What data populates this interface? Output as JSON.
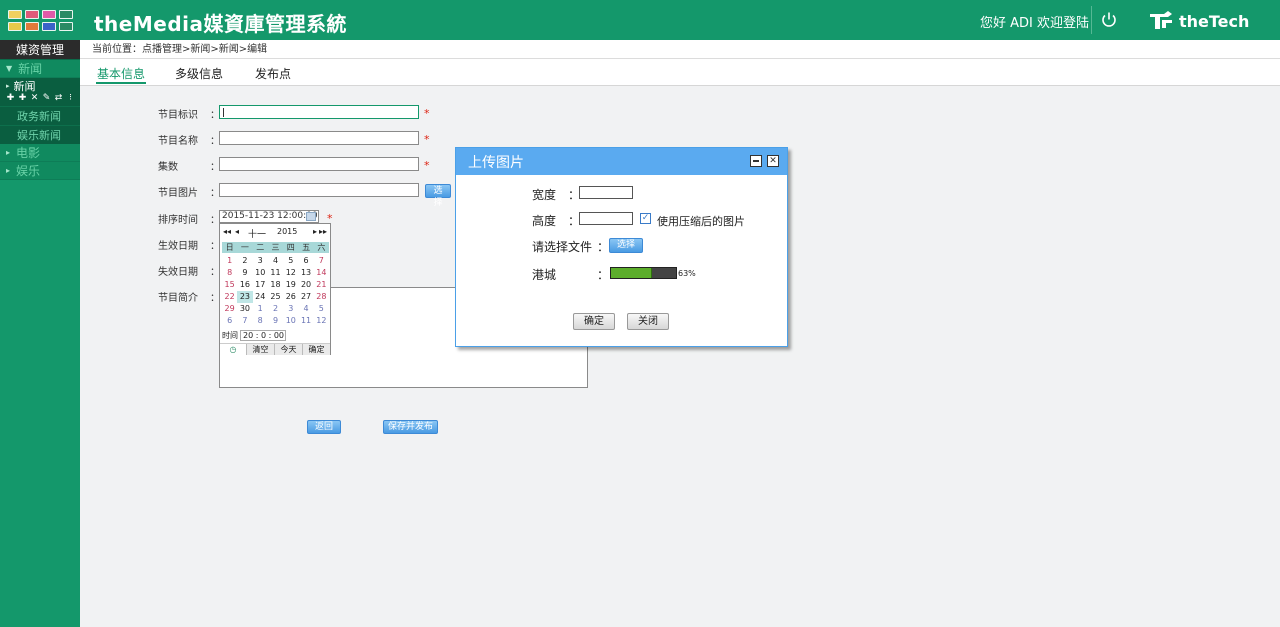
{
  "header": {
    "title": "theMedia媒資庫管理系統",
    "greeting": "您好 ADI 欢迎登陆",
    "brand": "theTech",
    "app_grid_colors": [
      "#f0d060",
      "#e05a7a",
      "#e05aa8",
      "#2a8a64",
      "#e8c94a",
      "#e07a3a",
      "#3a62c8",
      "#2a8a64"
    ]
  },
  "sidebar": {
    "top_label": "媒资管理",
    "sections": [
      {
        "label": "新闻"
      },
      {
        "label": "电影"
      },
      {
        "label": "娱乐"
      }
    ],
    "node_label": "新闻",
    "sub_items": [
      "政务新闻",
      "娱乐新闻"
    ]
  },
  "breadcrumb": "当前位置：点播管理>新闻>新闻>编辑",
  "tabs": [
    "基本信息",
    "多级信息",
    "发布点"
  ],
  "form": {
    "colon": "：",
    "required_mark": "*",
    "labels": {
      "id": "节目标识",
      "name": "节目名称",
      "episodes": "集数",
      "image": "节目图片",
      "sort_time": "排序时间",
      "effective_date": "生效日期",
      "expiry_date": "失效日期",
      "summary": "节目简介"
    },
    "values": {
      "id": "",
      "name": "",
      "episodes": "",
      "image": "",
      "sort_time": "2015-11-23 12:00:00"
    },
    "select_button": "选择",
    "back_button": "返回",
    "save_button": "保存并发布"
  },
  "datepicker": {
    "nav_prev_year": "◂◂",
    "nav_prev_month": "◂",
    "nav_next_month": "▸",
    "nav_next_year": "▸▸",
    "month": "十一",
    "year": "2015",
    "weekdays": [
      "日",
      "一",
      "二",
      "三",
      "四",
      "五",
      "六"
    ],
    "days": [
      {
        "d": "1",
        "t": "wkend"
      },
      {
        "d": "2"
      },
      {
        "d": "3"
      },
      {
        "d": "4"
      },
      {
        "d": "5"
      },
      {
        "d": "6"
      },
      {
        "d": "7",
        "t": "wkend"
      },
      {
        "d": "8",
        "t": "wkend"
      },
      {
        "d": "9"
      },
      {
        "d": "10"
      },
      {
        "d": "11"
      },
      {
        "d": "12"
      },
      {
        "d": "13"
      },
      {
        "d": "14",
        "t": "wkend"
      },
      {
        "d": "15",
        "t": "wkend"
      },
      {
        "d": "16"
      },
      {
        "d": "17"
      },
      {
        "d": "18"
      },
      {
        "d": "19"
      },
      {
        "d": "20"
      },
      {
        "d": "21",
        "t": "wkend"
      },
      {
        "d": "22",
        "t": "wkend"
      },
      {
        "d": "23",
        "t": "today"
      },
      {
        "d": "24"
      },
      {
        "d": "25"
      },
      {
        "d": "26"
      },
      {
        "d": "27"
      },
      {
        "d": "28",
        "t": "wkend"
      },
      {
        "d": "29",
        "t": "wkend"
      },
      {
        "d": "30"
      },
      {
        "d": "1",
        "t": "other"
      },
      {
        "d": "2",
        "t": "other"
      },
      {
        "d": "3",
        "t": "other"
      },
      {
        "d": "4",
        "t": "other"
      },
      {
        "d": "5",
        "t": "other"
      },
      {
        "d": "6",
        "t": "other"
      },
      {
        "d": "7",
        "t": "other"
      },
      {
        "d": "8",
        "t": "other"
      },
      {
        "d": "9",
        "t": "other"
      },
      {
        "d": "10",
        "t": "other"
      },
      {
        "d": "11",
        "t": "other"
      },
      {
        "d": "12",
        "t": "other"
      }
    ],
    "time_label": "时间",
    "time_value": "20 : 0 : 00",
    "clear": "清空",
    "today": "今天",
    "ok": "确定"
  },
  "modal": {
    "title": "上传图片",
    "width_label": "宽度",
    "height_label": "高度",
    "colon": "：",
    "compress_label": "使用压缩后的图片",
    "compress_checked": true,
    "file_label": "请选择文件",
    "select_button": "选择",
    "region_label": "港城",
    "progress_percent": 63,
    "progress_text": "63%",
    "ok": "确定",
    "close": "关闭"
  },
  "colors": {
    "brand_green": "#14986b",
    "modal_blue": "#5aaaf0",
    "required_red": "#d21"
  }
}
